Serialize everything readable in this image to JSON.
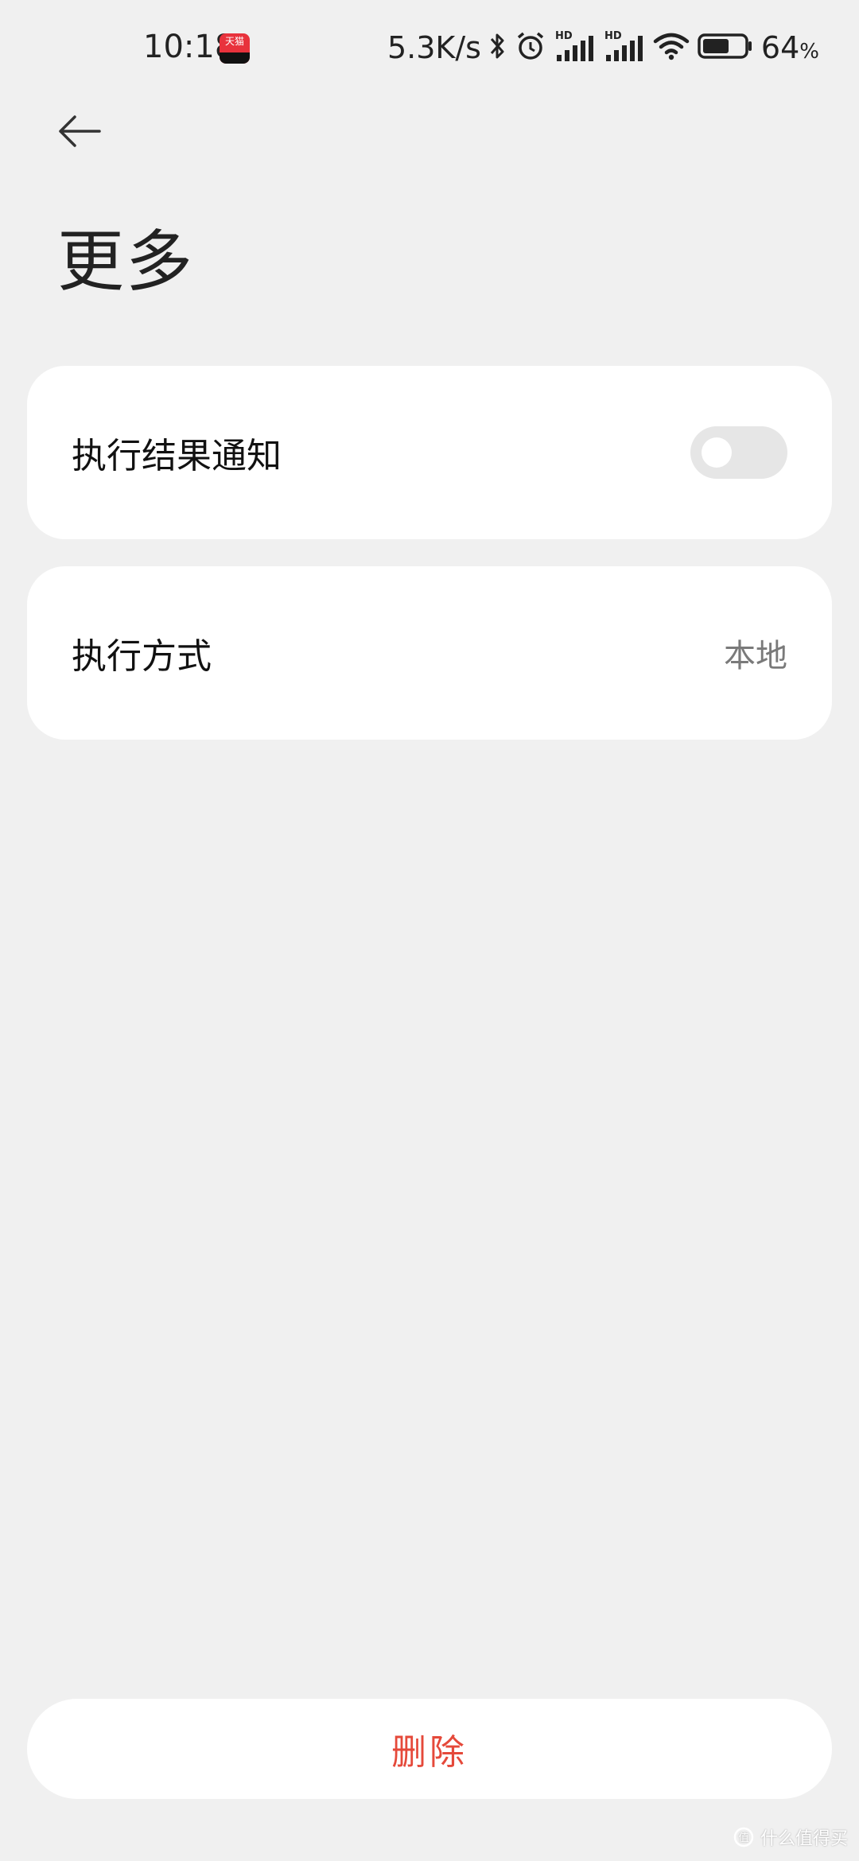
{
  "status_bar": {
    "time": "10:18",
    "app_badge": "天猫",
    "net_speed": "5.3K/s",
    "battery_number": "64",
    "battery_unit": "%",
    "battery_level": 0.64,
    "icons": [
      "bluetooth-icon",
      "alarm-icon",
      "hd-signal-icon",
      "hd-signal-icon",
      "wifi-icon",
      "battery-icon"
    ]
  },
  "header": {
    "back_icon": "arrow-left-icon",
    "title": "更多"
  },
  "settings": {
    "notify": {
      "label": "执行结果通知",
      "enabled": false
    },
    "mode": {
      "label": "执行方式",
      "value": "本地"
    }
  },
  "actions": {
    "delete_label": "删除"
  },
  "watermark": {
    "text": "什么值得买"
  },
  "colors": {
    "background": "#f0f0f0",
    "card": "#ffffff",
    "danger": "#e5493a",
    "toggle_off": "#e6e6e6",
    "secondary_text": "#7a7a7a"
  }
}
